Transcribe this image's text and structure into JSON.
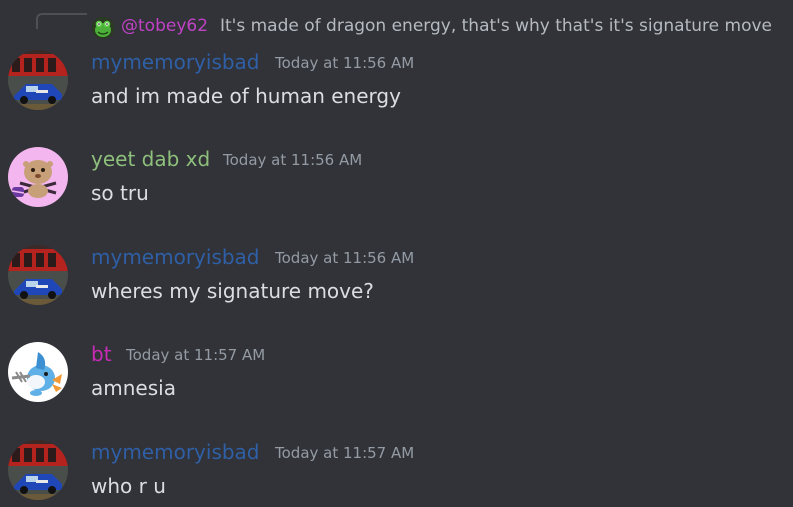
{
  "reply": {
    "mention": "@tobey62",
    "text": "It's made of dragon energy, that's why that's it's signature move",
    "avatar_icon": "frog-avatar-icon"
  },
  "colors": {
    "background": "#313338",
    "mymemoryisbad": "#2f5fa6",
    "yeetdabxd": "#8ec07c",
    "bt": "#c72bb6",
    "mention": "#c042c5"
  },
  "messages": [
    {
      "author": "mymemoryisbad",
      "timestamp": "Today at 11:56 AM",
      "content": "and im made of human energy",
      "avatar_icon": "red-car-avatar-icon"
    },
    {
      "author": "yeet dab xd",
      "timestamp": "Today at 11:56 AM",
      "content": "so tru",
      "avatar_icon": "pink-character-avatar-icon"
    },
    {
      "author": "mymemoryisbad",
      "timestamp": "Today at 11:56 AM",
      "content": "wheres my signature move?",
      "avatar_icon": "red-car-avatar-icon"
    },
    {
      "author": "bt",
      "timestamp": "Today at 11:57 AM",
      "content": "amnesia",
      "avatar_icon": "mudkip-avatar-icon"
    },
    {
      "author": "mymemoryisbad",
      "timestamp": "Today at 11:57 AM",
      "content": "who r u",
      "avatar_icon": "red-car-avatar-icon"
    }
  ]
}
